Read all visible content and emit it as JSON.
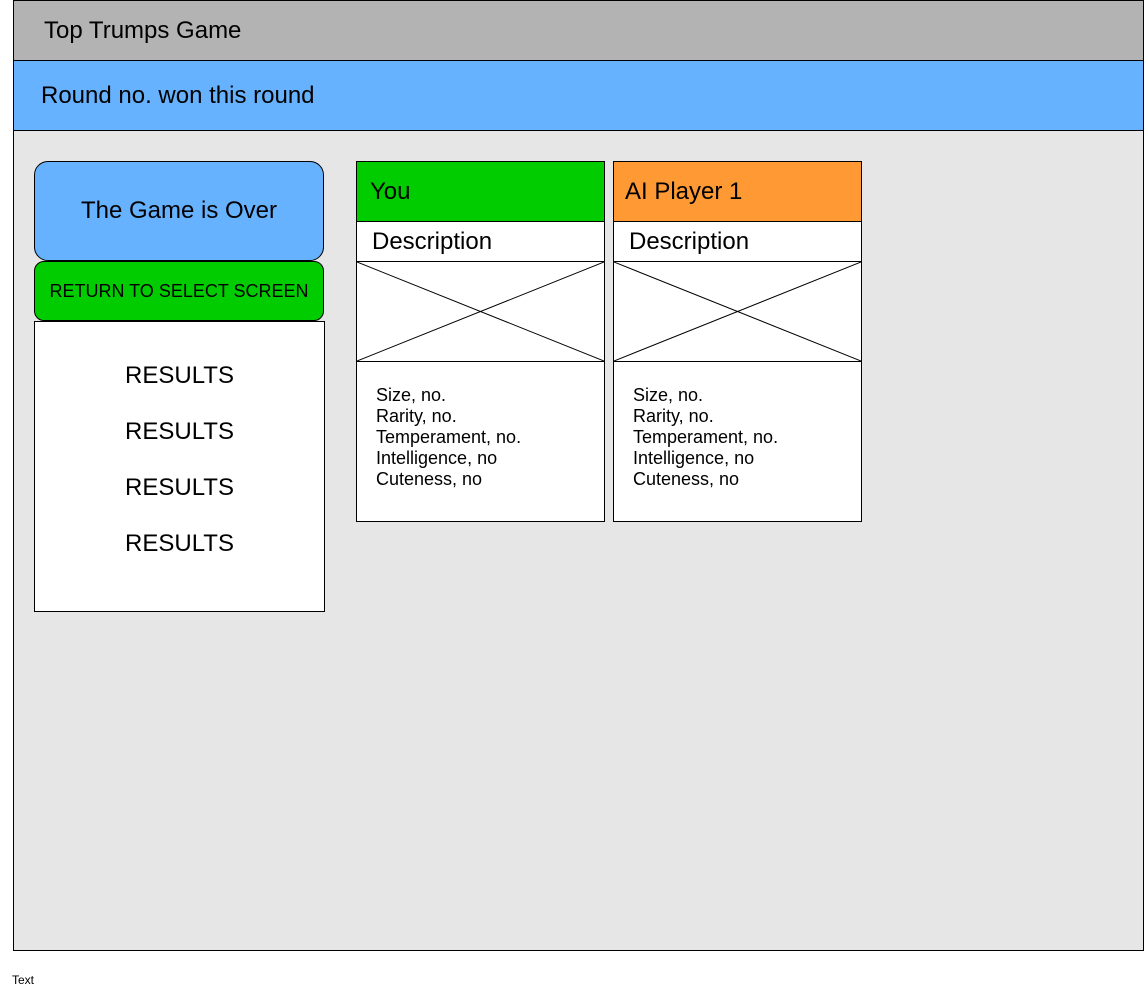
{
  "header": {
    "title": "Top Trumps Game"
  },
  "round_bar": {
    "text": "Round no. won this round"
  },
  "status": {
    "game_over": "The Game is Over"
  },
  "actions": {
    "return_label": "RETURN TO SELECT SCREEN"
  },
  "results": {
    "lines": [
      "RESULTS",
      "RESULTS",
      "RESULTS",
      "RESULTS"
    ]
  },
  "cards": [
    {
      "player": "You",
      "description": "Description",
      "stats": [
        "Size, no.",
        "Rarity, no.",
        "Temperament, no.",
        "Intelligence, no",
        "Cuteness, no"
      ]
    },
    {
      "player": "AI Player 1",
      "description": "Description",
      "stats": [
        "Size, no.",
        "Rarity, no.",
        "Temperament, no.",
        "Intelligence, no",
        "Cuteness, no"
      ]
    }
  ],
  "footer": {
    "text": "Text"
  },
  "colors": {
    "title_bar": "#b3b3b3",
    "round_bar": "#66b2ff",
    "background": "#e6e6e6",
    "you_header": "#00cc00",
    "ai_header": "#ff9933",
    "return_button": "#00cc00"
  }
}
